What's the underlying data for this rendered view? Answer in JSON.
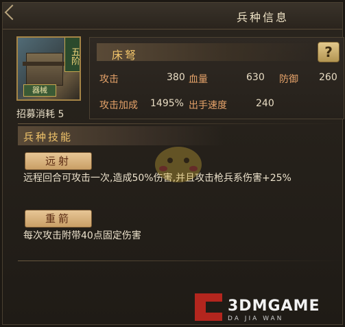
{
  "window": {
    "title": "兵种信息"
  },
  "unit": {
    "name": "床弩",
    "tier": "五阶",
    "category": "器械",
    "recruit_cost_label": "招募消耗",
    "recruit_cost_value": "5"
  },
  "help_button": {
    "label": "?"
  },
  "stats": {
    "attack_label": "攻击",
    "attack_value": "380",
    "hp_label": "血量",
    "hp_value": "630",
    "defense_label": "防御",
    "defense_value": "260",
    "attack_bonus_label": "攻击加成",
    "attack_bonus_value": "1495%",
    "speed_label": "出手速度",
    "speed_value": "240"
  },
  "skills_section": {
    "title": "兵种技能",
    "skills": [
      {
        "name": "远射",
        "description": "远程回合可攻击一次,造成50%伤害,并且攻击枪兵系伤害+25%"
      },
      {
        "name": "重箭",
        "description": "每次攻击附带40点固定伤害"
      }
    ]
  },
  "watermark": {
    "text": "3DMGAME",
    "sub": "DA JIA WAN"
  },
  "colors": {
    "accent": "#f2c56b",
    "stat_label": "#e6a36a",
    "panel_bg": "#2a251e"
  }
}
